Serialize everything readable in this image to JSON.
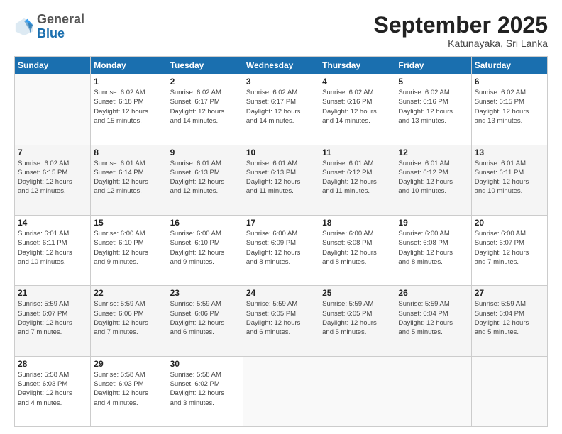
{
  "logo": {
    "general": "General",
    "blue": "Blue"
  },
  "header": {
    "month": "September 2025",
    "location": "Katunayaka, Sri Lanka"
  },
  "weekdays": [
    "Sunday",
    "Monday",
    "Tuesday",
    "Wednesday",
    "Thursday",
    "Friday",
    "Saturday"
  ],
  "weeks": [
    [
      {
        "day": "",
        "info": ""
      },
      {
        "day": "1",
        "info": "Sunrise: 6:02 AM\nSunset: 6:18 PM\nDaylight: 12 hours\nand 15 minutes."
      },
      {
        "day": "2",
        "info": "Sunrise: 6:02 AM\nSunset: 6:17 PM\nDaylight: 12 hours\nand 14 minutes."
      },
      {
        "day": "3",
        "info": "Sunrise: 6:02 AM\nSunset: 6:17 PM\nDaylight: 12 hours\nand 14 minutes."
      },
      {
        "day": "4",
        "info": "Sunrise: 6:02 AM\nSunset: 6:16 PM\nDaylight: 12 hours\nand 14 minutes."
      },
      {
        "day": "5",
        "info": "Sunrise: 6:02 AM\nSunset: 6:16 PM\nDaylight: 12 hours\nand 13 minutes."
      },
      {
        "day": "6",
        "info": "Sunrise: 6:02 AM\nSunset: 6:15 PM\nDaylight: 12 hours\nand 13 minutes."
      }
    ],
    [
      {
        "day": "7",
        "info": "Sunrise: 6:02 AM\nSunset: 6:15 PM\nDaylight: 12 hours\nand 12 minutes."
      },
      {
        "day": "8",
        "info": "Sunrise: 6:01 AM\nSunset: 6:14 PM\nDaylight: 12 hours\nand 12 minutes."
      },
      {
        "day": "9",
        "info": "Sunrise: 6:01 AM\nSunset: 6:13 PM\nDaylight: 12 hours\nand 12 minutes."
      },
      {
        "day": "10",
        "info": "Sunrise: 6:01 AM\nSunset: 6:13 PM\nDaylight: 12 hours\nand 11 minutes."
      },
      {
        "day": "11",
        "info": "Sunrise: 6:01 AM\nSunset: 6:12 PM\nDaylight: 12 hours\nand 11 minutes."
      },
      {
        "day": "12",
        "info": "Sunrise: 6:01 AM\nSunset: 6:12 PM\nDaylight: 12 hours\nand 10 minutes."
      },
      {
        "day": "13",
        "info": "Sunrise: 6:01 AM\nSunset: 6:11 PM\nDaylight: 12 hours\nand 10 minutes."
      }
    ],
    [
      {
        "day": "14",
        "info": "Sunrise: 6:01 AM\nSunset: 6:11 PM\nDaylight: 12 hours\nand 10 minutes."
      },
      {
        "day": "15",
        "info": "Sunrise: 6:00 AM\nSunset: 6:10 PM\nDaylight: 12 hours\nand 9 minutes."
      },
      {
        "day": "16",
        "info": "Sunrise: 6:00 AM\nSunset: 6:10 PM\nDaylight: 12 hours\nand 9 minutes."
      },
      {
        "day": "17",
        "info": "Sunrise: 6:00 AM\nSunset: 6:09 PM\nDaylight: 12 hours\nand 8 minutes."
      },
      {
        "day": "18",
        "info": "Sunrise: 6:00 AM\nSunset: 6:08 PM\nDaylight: 12 hours\nand 8 minutes."
      },
      {
        "day": "19",
        "info": "Sunrise: 6:00 AM\nSunset: 6:08 PM\nDaylight: 12 hours\nand 8 minutes."
      },
      {
        "day": "20",
        "info": "Sunrise: 6:00 AM\nSunset: 6:07 PM\nDaylight: 12 hours\nand 7 minutes."
      }
    ],
    [
      {
        "day": "21",
        "info": "Sunrise: 5:59 AM\nSunset: 6:07 PM\nDaylight: 12 hours\nand 7 minutes."
      },
      {
        "day": "22",
        "info": "Sunrise: 5:59 AM\nSunset: 6:06 PM\nDaylight: 12 hours\nand 7 minutes."
      },
      {
        "day": "23",
        "info": "Sunrise: 5:59 AM\nSunset: 6:06 PM\nDaylight: 12 hours\nand 6 minutes."
      },
      {
        "day": "24",
        "info": "Sunrise: 5:59 AM\nSunset: 6:05 PM\nDaylight: 12 hours\nand 6 minutes."
      },
      {
        "day": "25",
        "info": "Sunrise: 5:59 AM\nSunset: 6:05 PM\nDaylight: 12 hours\nand 5 minutes."
      },
      {
        "day": "26",
        "info": "Sunrise: 5:59 AM\nSunset: 6:04 PM\nDaylight: 12 hours\nand 5 minutes."
      },
      {
        "day": "27",
        "info": "Sunrise: 5:59 AM\nSunset: 6:04 PM\nDaylight: 12 hours\nand 5 minutes."
      }
    ],
    [
      {
        "day": "28",
        "info": "Sunrise: 5:58 AM\nSunset: 6:03 PM\nDaylight: 12 hours\nand 4 minutes."
      },
      {
        "day": "29",
        "info": "Sunrise: 5:58 AM\nSunset: 6:03 PM\nDaylight: 12 hours\nand 4 minutes."
      },
      {
        "day": "30",
        "info": "Sunrise: 5:58 AM\nSunset: 6:02 PM\nDaylight: 12 hours\nand 3 minutes."
      },
      {
        "day": "",
        "info": ""
      },
      {
        "day": "",
        "info": ""
      },
      {
        "day": "",
        "info": ""
      },
      {
        "day": "",
        "info": ""
      }
    ]
  ]
}
